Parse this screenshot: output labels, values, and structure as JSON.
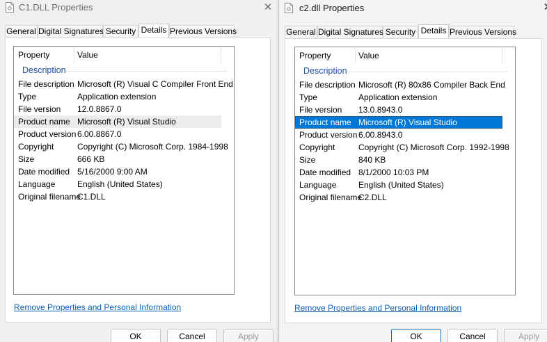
{
  "left": {
    "title": "C1.DLL Properties",
    "tabs": [
      "General",
      "Digital Signatures",
      "Security",
      "Details",
      "Previous Versions"
    ],
    "active_tab": "Details",
    "columns": {
      "property": "Property",
      "value": "Value"
    },
    "section": "Description",
    "rows": [
      {
        "property": "File description",
        "value": "Microsoft (R) Visual C Compiler Front End"
      },
      {
        "property": "Type",
        "value": "Application extension"
      },
      {
        "property": "File version",
        "value": "12.0.8867.0"
      },
      {
        "property": "Product name",
        "value": "Microsoft (R) Visual Studio"
      },
      {
        "property": "Product version",
        "value": "6.00.8867.0"
      },
      {
        "property": "Copyright",
        "value": "Copyright (C) Microsoft Corp. 1984-1998"
      },
      {
        "property": "Size",
        "value": "666 KB"
      },
      {
        "property": "Date modified",
        "value": "5/16/2000 9:00 AM"
      },
      {
        "property": "Language",
        "value": "English (United States)"
      },
      {
        "property": "Original filename",
        "value": "C1.DLL"
      }
    ],
    "selected_row": "Product name",
    "selection_style": "inactive-grey",
    "remove_link": "Remove Properties and Personal Information",
    "buttons": {
      "ok": "OK",
      "cancel": "Cancel",
      "apply": "Apply"
    }
  },
  "right": {
    "title": "c2.dll Properties",
    "tabs": [
      "General",
      "Digital Signatures",
      "Security",
      "Details",
      "Previous Versions"
    ],
    "active_tab": "Details",
    "columns": {
      "property": "Property",
      "value": "Value"
    },
    "section": "Description",
    "rows": [
      {
        "property": "File description",
        "value": "Microsoft (R) 80x86 Compiler Back End"
      },
      {
        "property": "Type",
        "value": "Application extension"
      },
      {
        "property": "File version",
        "value": "13.0.8943.0"
      },
      {
        "property": "Product name",
        "value": "Microsoft (R) Visual Studio"
      },
      {
        "property": "Product version",
        "value": "6.00.8943.0"
      },
      {
        "property": "Copyright",
        "value": "Copyright (C) Microsoft Corp. 1992-1998"
      },
      {
        "property": "Size",
        "value": "840 KB"
      },
      {
        "property": "Date modified",
        "value": "8/1/2000 10:03 PM"
      },
      {
        "property": "Language",
        "value": "English (United States)"
      },
      {
        "property": "Original filename",
        "value": "C2.DLL"
      }
    ],
    "selected_row": "Product name",
    "selection_style": "active-blue",
    "remove_link": "Remove Properties and Personal Information",
    "buttons": {
      "ok": "OK",
      "cancel": "Cancel",
      "apply": "Apply"
    }
  },
  "colors": {
    "selection_active": "#0078d7",
    "selection_inactive": "#ececec",
    "link": "#0a5fb4",
    "section_label": "#1f4ea3"
  },
  "icons": {
    "title_icon": "document-gear-icon",
    "close": "close-icon"
  }
}
